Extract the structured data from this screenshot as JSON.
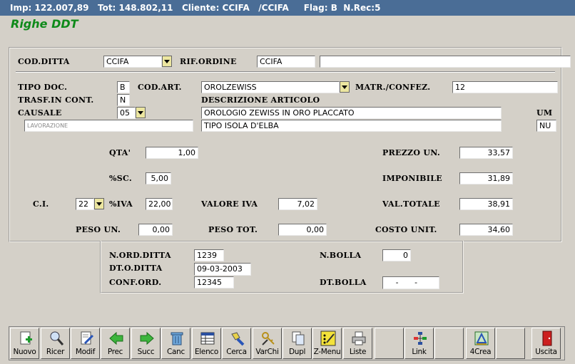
{
  "status_bar": {
    "text": "Imp: 122.007,89   Tot: 148.802,11   Cliente: CCIFA   /CCIFA     Flag: B  N.Rec:5"
  },
  "form_title": "Righe DDT",
  "header": {
    "cod_ditta_label": "COD.DITTA",
    "cod_ditta_value": "CCIFA",
    "rif_ordine_label": "RIF.ORDINE",
    "rif_ordine_value": "CCIFA",
    "rif_ordine_extra": ""
  },
  "detail": {
    "tipo_doc_label": "TIPO DOC.",
    "tipo_doc_value": "B",
    "trasf_label": "TRASF.IN CONT.",
    "trasf_value": "N",
    "causale_label": "CAUSALE",
    "causale_value": "05",
    "causale_desc": "LAVORAZIONE",
    "cod_art_label": "COD.ART.",
    "cod_art_value": "OROLZEWISS",
    "matr_label": "MATR./CONFEZ.",
    "matr_value": "12",
    "descr_label": "DESCRIZIONE ARTICOLO",
    "descr_line1": "OROLOGIO ZEWISS IN ORO PLACCATO",
    "descr_line2": "TIPO ISOLA D'ELBA",
    "um_label": "UM",
    "um_value": "NU"
  },
  "amounts": {
    "qta_label": "QTA'",
    "qta_value": "1,00",
    "sc_label": "%SC.",
    "sc_value": "5,00",
    "ci_label": "C.I.",
    "ci_value": "22",
    "iva_label": "%IVA",
    "iva_value": "22,00",
    "valore_iva_label": "VALORE IVA",
    "valore_iva_value": "7,02",
    "prezzo_label": "PREZZO UN.",
    "prezzo_value": "33,57",
    "imponibile_label": "IMPONIBILE",
    "imponibile_value": "31,89",
    "val_totale_label": "VAL.TOTALE",
    "val_totale_value": "38,91",
    "peso_un_label": "PESO UN.",
    "peso_un_value": "0,00",
    "peso_tot_label": "PESO TOT.",
    "peso_tot_value": "0,00",
    "costo_label": "COSTO UNIT.",
    "costo_value": "34,60"
  },
  "order": {
    "n_ord_label": "N.ORD.DITTA",
    "n_ord_value": "1239",
    "dt_ord_label": "DT.O.DITTA",
    "dt_ord_value": "09-03-2003",
    "conf_ord_label": "CONF.ORD.",
    "conf_ord_value": "12345",
    "n_bolla_label": "N.BOLLA",
    "n_bolla_value": "0",
    "dt_bolla_label": "DT.BOLLA",
    "dt_bolla_value": "  -   -  "
  },
  "toolbar": [
    {
      "label": "Nuovo",
      "icon": "new-document-icon"
    },
    {
      "label": "Ricer",
      "icon": "search-magnifier-icon"
    },
    {
      "label": "Modif",
      "icon": "edit-document-icon"
    },
    {
      "label": "Prec",
      "icon": "arrow-left-icon"
    },
    {
      "label": "Succ",
      "icon": "arrow-right-icon"
    },
    {
      "label": "Canc",
      "icon": "trash-icon"
    },
    {
      "label": "Elenco",
      "icon": "list-table-icon"
    },
    {
      "label": "Cerca",
      "icon": "flashlight-icon"
    },
    {
      "label": "VarChi",
      "icon": "keys-icon"
    },
    {
      "label": "Dupl",
      "icon": "duplicate-icon"
    },
    {
      "label": "Z-Menu",
      "icon": "menu-pencil-icon"
    },
    {
      "label": "Liste",
      "icon": "printer-icon"
    },
    {
      "label": "",
      "icon": ""
    },
    {
      "label": "Link",
      "icon": "link-network-icon"
    },
    {
      "label": "",
      "icon": ""
    },
    {
      "label": "4Crea",
      "icon": "create-drawing-icon"
    },
    {
      "label": "",
      "icon": ""
    },
    {
      "label": "Uscita",
      "icon": "exit-door-icon"
    }
  ]
}
